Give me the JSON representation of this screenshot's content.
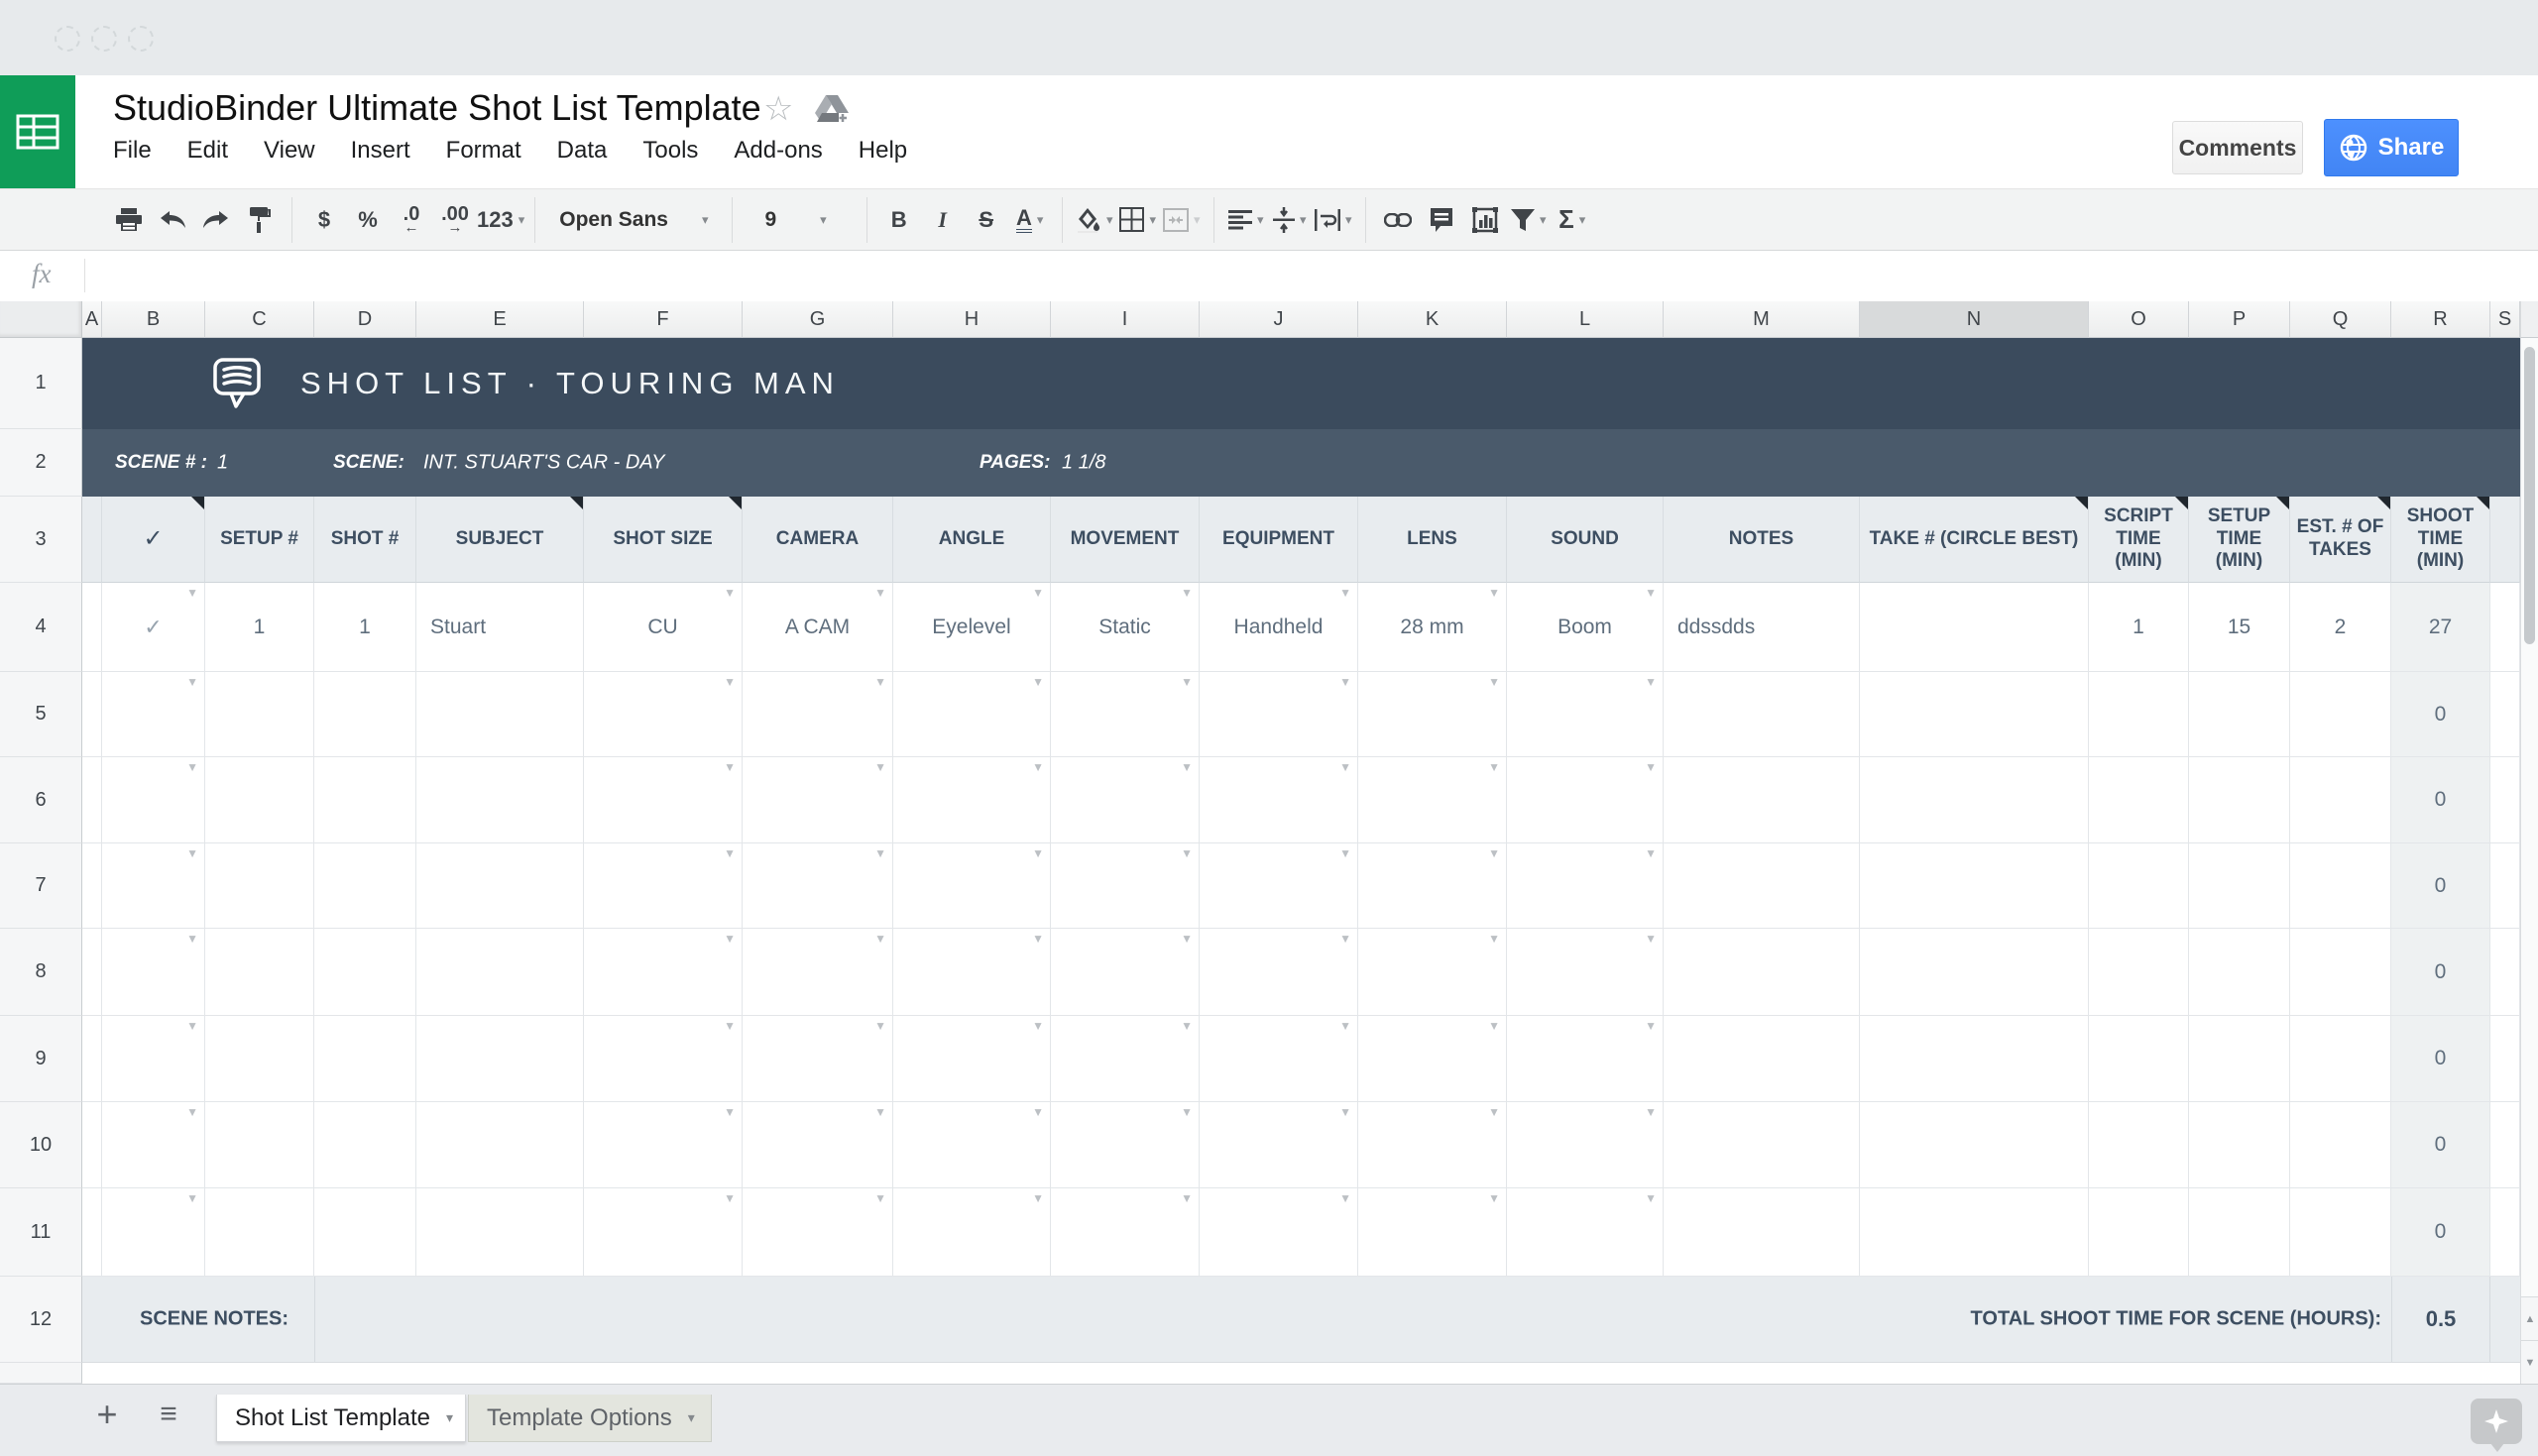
{
  "window": {
    "traffic_light_count": 3
  },
  "header": {
    "doc_title": "StudioBinder Ultimate Shot List Template",
    "menu": [
      "File",
      "Edit",
      "View",
      "Insert",
      "Format",
      "Data",
      "Tools",
      "Add-ons",
      "Help"
    ],
    "comments_label": "Comments",
    "share_label": "Share"
  },
  "toolbar": {
    "labels": {
      "currency": "$",
      "percent": "%",
      "decimal_decrease": ".0",
      "decimal_increase": ".00",
      "number_format": "123",
      "bold": "B",
      "italic": "I",
      "strikethrough": "S",
      "text_color": "A",
      "functions": "Σ"
    },
    "font_name": "Open Sans",
    "font_size": "9",
    "icon_names": [
      "print-icon",
      "undo-icon",
      "redo-icon",
      "paint-format-icon",
      "fill-color-icon",
      "borders-icon",
      "merge-cells-icon",
      "horizontal-align-icon",
      "vertical-align-icon",
      "text-wrap-icon",
      "insert-link-icon",
      "insert-comment-icon",
      "insert-chart-icon",
      "filter-icon",
      "functions-icon"
    ]
  },
  "formula_bar": {
    "fx_label": "fx",
    "value": ""
  },
  "grid": {
    "column_letters": [
      "A",
      "B",
      "C",
      "D",
      "E",
      "F",
      "G",
      "H",
      "I",
      "J",
      "K",
      "L",
      "M",
      "N",
      "O",
      "P",
      "Q",
      "R",
      "S"
    ],
    "selected_column": "N",
    "row_numbers": [
      "1",
      "2",
      "3",
      "4",
      "5",
      "6",
      "7",
      "8",
      "9",
      "10",
      "11",
      "12"
    ],
    "title_row": {
      "title": "SHOT LIST · TOURING MAN"
    },
    "scene_row": {
      "scene_num_label": "SCENE # :",
      "scene_num": "1",
      "scene_label": "SCENE:",
      "scene_value": "INT. STUART'S CAR - DAY",
      "pages_label": "PAGES:",
      "pages_value": "1 1/8"
    },
    "columns": [
      {
        "letter": "A"
      },
      {
        "letter": "B",
        "header": "✓",
        "row4": "✓",
        "dropdown": true,
        "note_corner": true
      },
      {
        "letter": "C",
        "header": "SETUP #",
        "row4": "1"
      },
      {
        "letter": "D",
        "header": "SHOT #",
        "row4": "1"
      },
      {
        "letter": "E",
        "header": "SUBJECT",
        "row4": "Stuart",
        "align": "left",
        "note_corner": true
      },
      {
        "letter": "F",
        "header": "SHOT SIZE",
        "row4": "CU",
        "dropdown": true,
        "note_corner": true
      },
      {
        "letter": "G",
        "header": "CAMERA",
        "row4": "A CAM",
        "dropdown": true
      },
      {
        "letter": "H",
        "header": "ANGLE",
        "row4": "Eyelevel",
        "dropdown": true
      },
      {
        "letter": "I",
        "header": "MOVEMENT",
        "row4": "Static",
        "dropdown": true
      },
      {
        "letter": "J",
        "header": "EQUIPMENT",
        "row4": "Handheld",
        "dropdown": true
      },
      {
        "letter": "K",
        "header": "LENS",
        "row4": "28 mm",
        "dropdown": true
      },
      {
        "letter": "L",
        "header": "SOUND",
        "row4": "Boom",
        "dropdown": true
      },
      {
        "letter": "M",
        "header": "NOTES",
        "row4": "ddssdds",
        "align": "left"
      },
      {
        "letter": "N",
        "header": "TAKE # (CIRCLE BEST)",
        "row4": "",
        "note_corner": true
      },
      {
        "letter": "O",
        "header": "SCRIPT TIME (MIN)",
        "row4": "1",
        "note_corner": true
      },
      {
        "letter": "P",
        "header": "SETUP TIME (MIN)",
        "row4": "15",
        "note_corner": true
      },
      {
        "letter": "Q",
        "header": "EST. # OF TAKES",
        "row4": "2",
        "note_corner": true
      },
      {
        "letter": "R",
        "header": "SHOOT TIME (MIN)",
        "row4": "27",
        "note_corner": true,
        "shaded": true
      },
      {
        "letter": "S"
      }
    ],
    "empty_row_shoot_time": "0",
    "footer_row": {
      "notes_label": "SCENE NOTES:",
      "total_label": "TOTAL SHOOT TIME FOR SCENE (HOURS):",
      "total_value": "0.5"
    }
  },
  "sheet_tabs": {
    "active_tab": "Shot List Template",
    "inactive_tab": "Template Options"
  }
}
